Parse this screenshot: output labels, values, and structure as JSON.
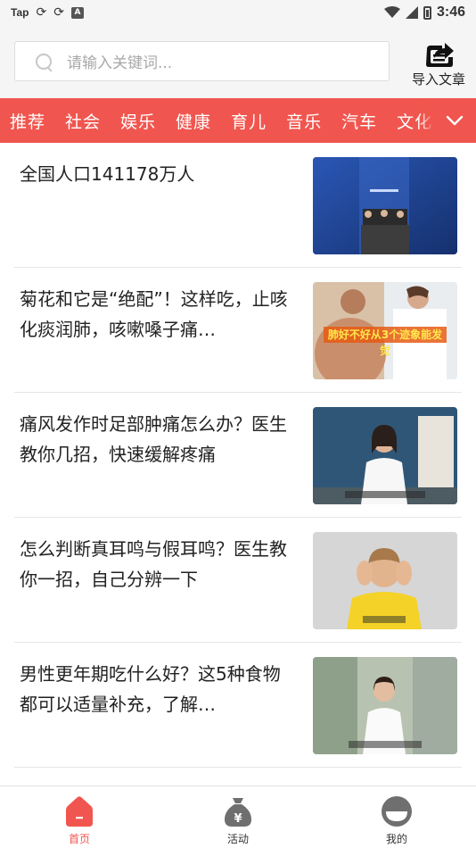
{
  "status_bar": {
    "app_label": "Tap",
    "time": "3:46",
    "left_icons": [
      "sync-icon",
      "sync-icon",
      "text-a-icon"
    ],
    "right_icons": [
      "wifi-icon",
      "signal-icon",
      "battery-icon"
    ]
  },
  "search": {
    "placeholder": "请输入关键词...",
    "import_label": "导入文章"
  },
  "categories": [
    "推荐",
    "社会",
    "娱乐",
    "健康",
    "育儿",
    "音乐",
    "汽车",
    "文化"
  ],
  "feed": [
    {
      "title": "全国人口141178万人",
      "thumb_text": ""
    },
    {
      "title": "菊花和它是“绝配”！这样吃，止咳化痰润肺，咳嗽嗓子痛…",
      "thumb_text": "肺好不好从3个迹象能发觉"
    },
    {
      "title": "痛风发作时足部肿痛怎么办？医生教你几招，快速缓解疼痛",
      "thumb_text": ""
    },
    {
      "title": "怎么判断真耳鸣与假耳鸣？医生教你一招，自己分辨一下",
      "thumb_text": ""
    },
    {
      "title": "男性更年期吃什么好？这5种食物都可以适量补充，了解…",
      "thumb_text": ""
    }
  ],
  "bottom_nav": [
    {
      "label": "首页",
      "icon": "home-icon",
      "active": true
    },
    {
      "label": "活动",
      "icon": "money-bag-icon",
      "active": false
    },
    {
      "label": "我的",
      "icon": "profile-icon",
      "active": false
    }
  ],
  "colors": {
    "accent": "#f0564f",
    "header_bg": "#f5f5f5",
    "inactive_icon": "#6f6f6f"
  }
}
